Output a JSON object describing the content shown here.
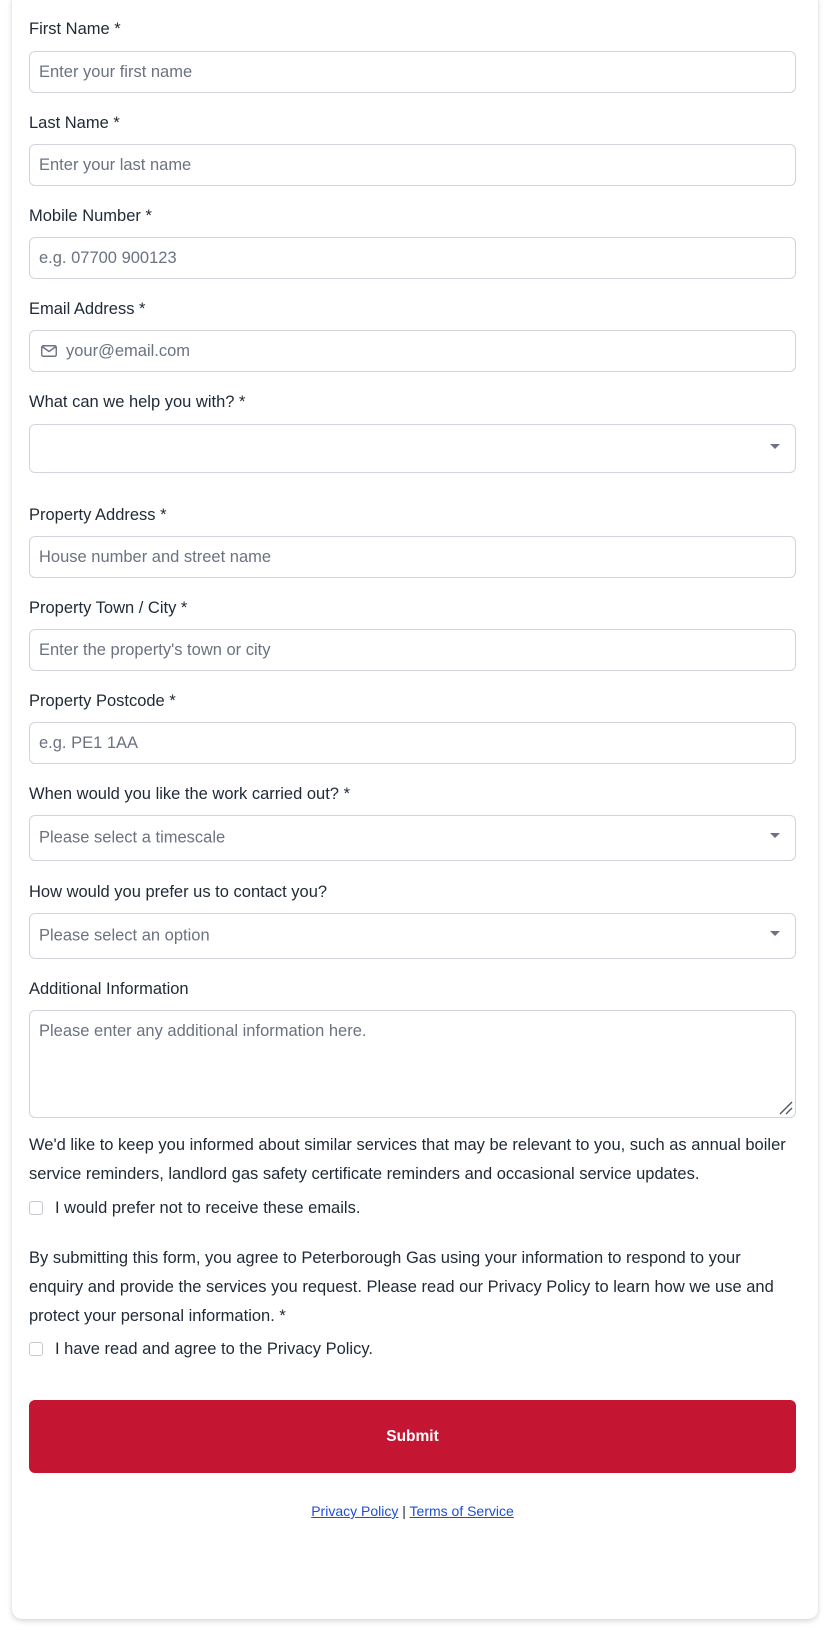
{
  "form": {
    "first_name": {
      "label": "First Name *",
      "placeholder": "Enter your first name"
    },
    "last_name": {
      "label": "Last Name *",
      "placeholder": "Enter your last name"
    },
    "mobile": {
      "label": "Mobile Number *",
      "placeholder": "e.g. 07700 900123"
    },
    "email": {
      "label": "Email Address *",
      "placeholder": "your@email.com",
      "icon": "mail-icon"
    },
    "help_with": {
      "label": "What can we help you with? *",
      "value": ""
    },
    "address": {
      "label": "Property Address *",
      "placeholder": "House number and street name"
    },
    "town": {
      "label": "Property Town / City *",
      "placeholder": "Enter the property's town or city"
    },
    "postcode": {
      "label": "Property Postcode *",
      "placeholder": "e.g. PE1 1AA"
    },
    "timescale": {
      "label": "When would you like the work carried out? *",
      "value": "Please select a timescale"
    },
    "contact_pref": {
      "label": "How would you prefer us to contact you?",
      "value": "Please select an option"
    },
    "additional": {
      "label": "Additional Information",
      "placeholder": "Please enter any additional information here."
    },
    "marketing_text": "We'd like to keep you informed about similar services that may be relevant to you, such as annual boiler service reminders, landlord gas safety certificate reminders and occasional service updates.",
    "marketing_opt_out": {
      "label": "I would prefer not to receive these emails.",
      "checked": false
    },
    "privacy_text": "By submitting this form, you agree to Peterborough Gas using your information to respond to your enquiry and provide the services you request. Please read our Privacy Policy to learn how we use and protect your personal information. *",
    "privacy_agree": {
      "label": "I have read and agree to the Privacy Policy.",
      "checked": false
    },
    "submit_label": "Submit"
  },
  "footer": {
    "privacy_link": "Privacy Policy",
    "separator": "|",
    "terms_link": "Terms of Service"
  },
  "colors": {
    "submit_bg": "#c41633",
    "link": "#1d4ed8",
    "border": "#d1d5db"
  }
}
